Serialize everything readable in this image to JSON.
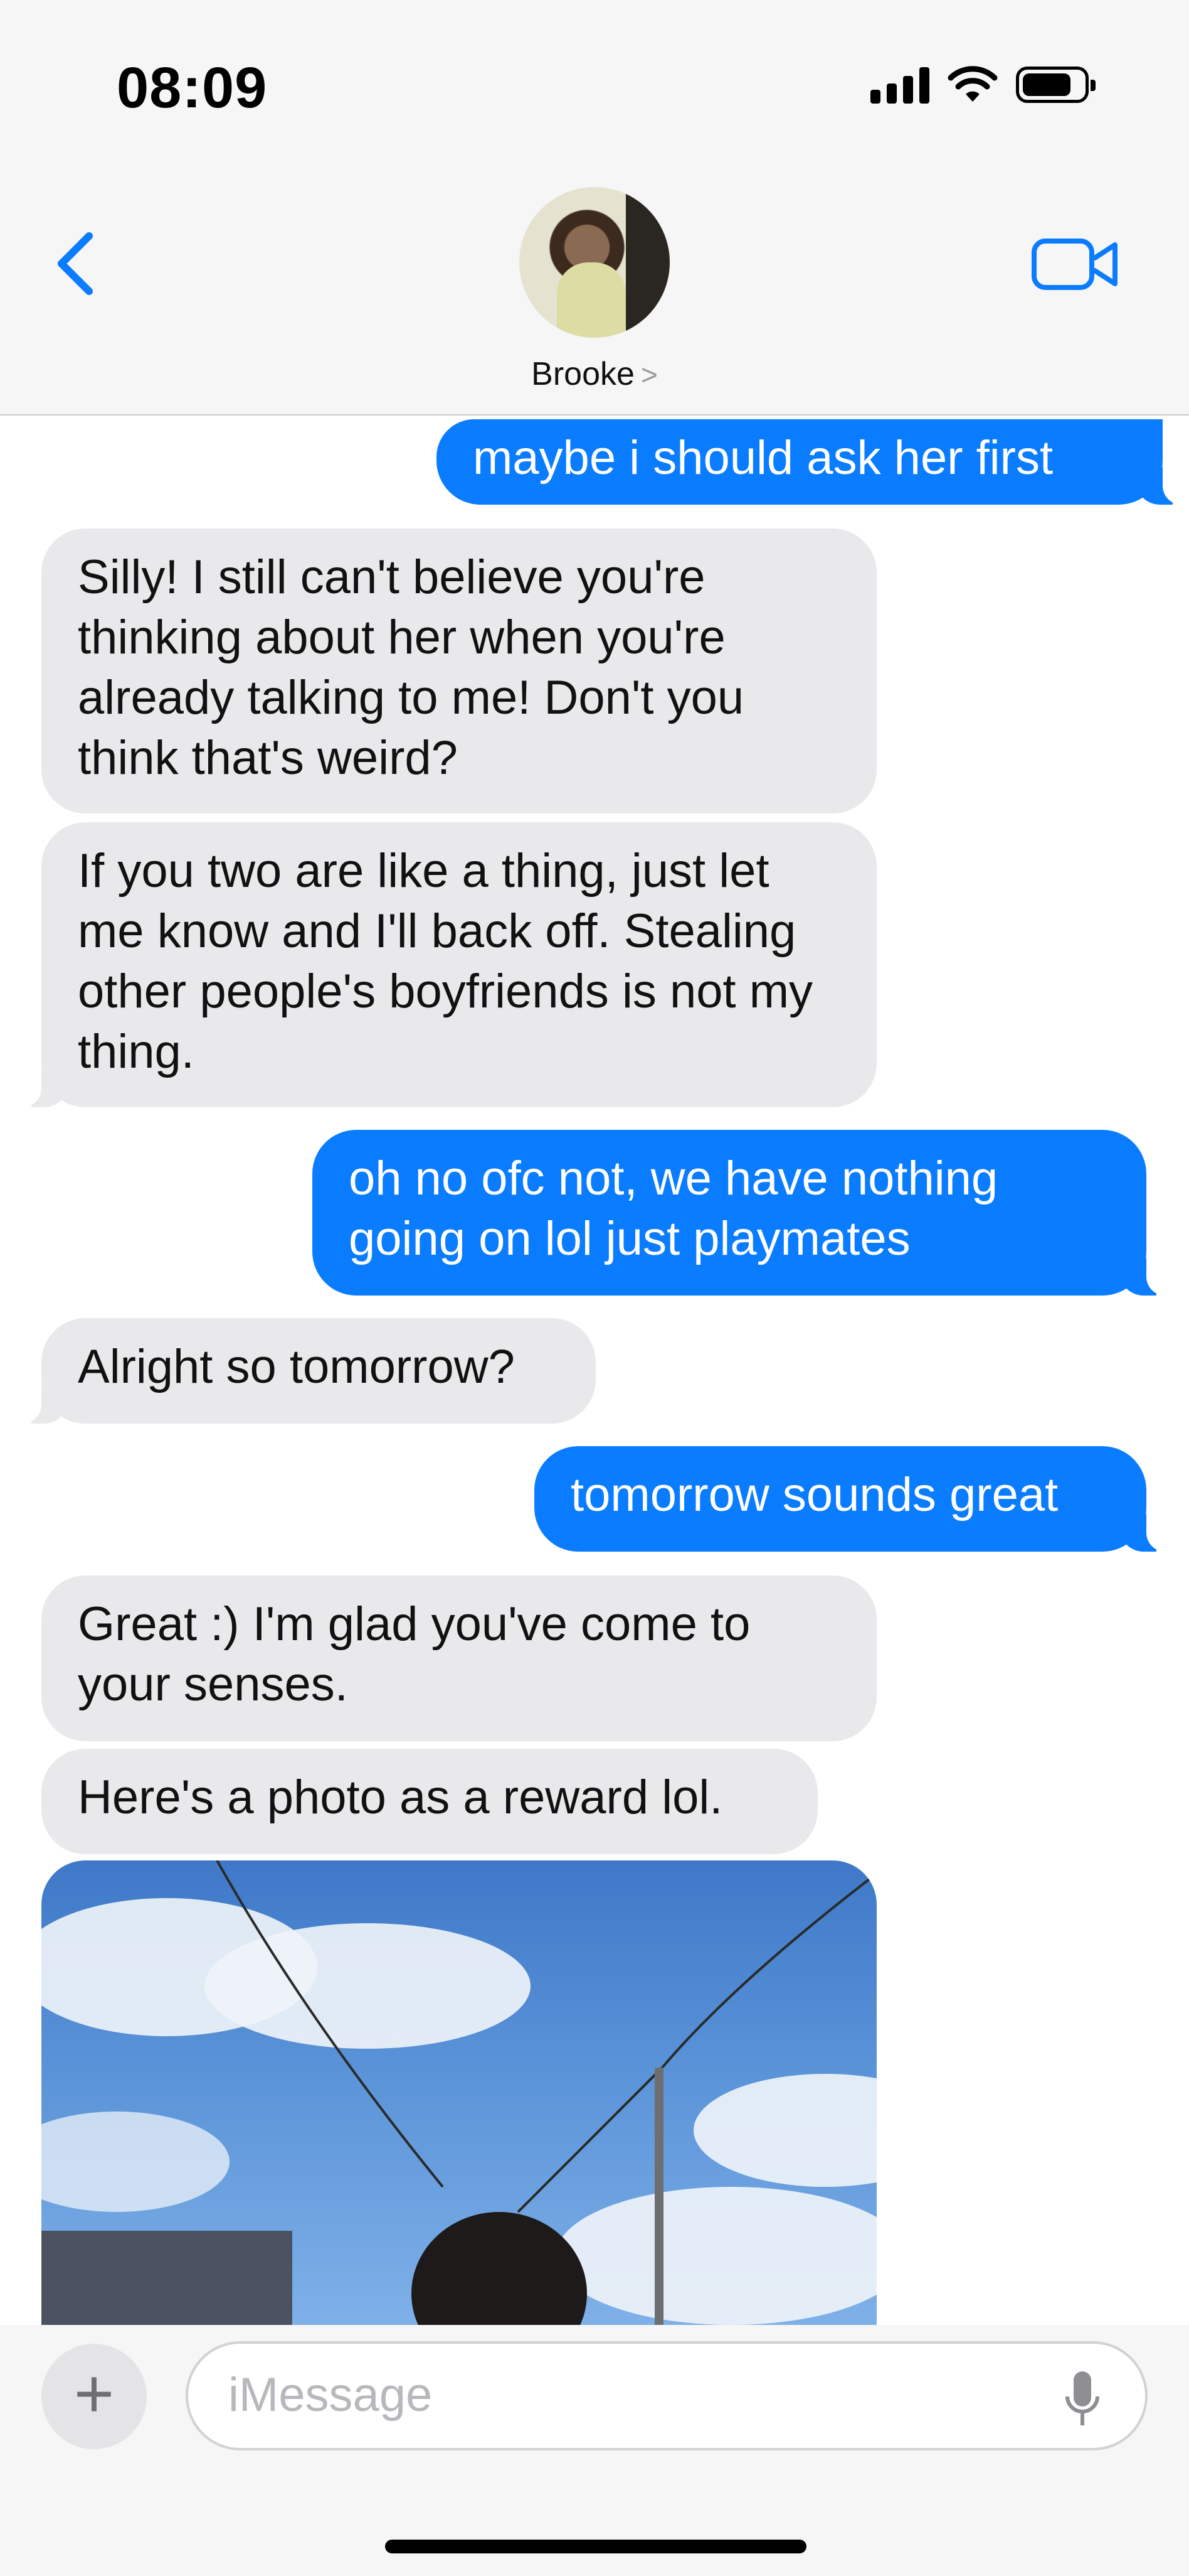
{
  "status_bar": {
    "time": "08:09"
  },
  "header": {
    "contact_name": "Brooke",
    "chevron": ">"
  },
  "messages": [
    {
      "from": "me",
      "text": "maybe i should ask her first"
    },
    {
      "from": "them",
      "text": "Silly! I still can't believe you're thinking about her when you're already talking to me! Don't you think that's weird?"
    },
    {
      "from": "them",
      "text": "If you two are like a thing, just let me know and I'll back off. Stealing other people's boyfriends is not my thing."
    },
    {
      "from": "me",
      "text": "oh no ofc not, we have nothing going on lol just playmates"
    },
    {
      "from": "them",
      "text": "Alright so tomorrow?"
    },
    {
      "from": "me",
      "text": "tomorrow sounds great"
    },
    {
      "from": "them",
      "text": "Great :) I'm glad you've come to your senses."
    },
    {
      "from": "them",
      "text": "Here's a photo as a reward lol."
    }
  ],
  "composer": {
    "placeholder": "iMessage",
    "plus": "+"
  },
  "icons": {
    "back": "chevron-left-icon",
    "video": "video-camera-icon",
    "mic": "microphone-icon",
    "wifi": "wifi-icon",
    "battery": "battery-icon",
    "signal": "cellular-signal-icon"
  },
  "colors": {
    "accent": "#0a7cff",
    "incoming": "#e9e9eb"
  }
}
